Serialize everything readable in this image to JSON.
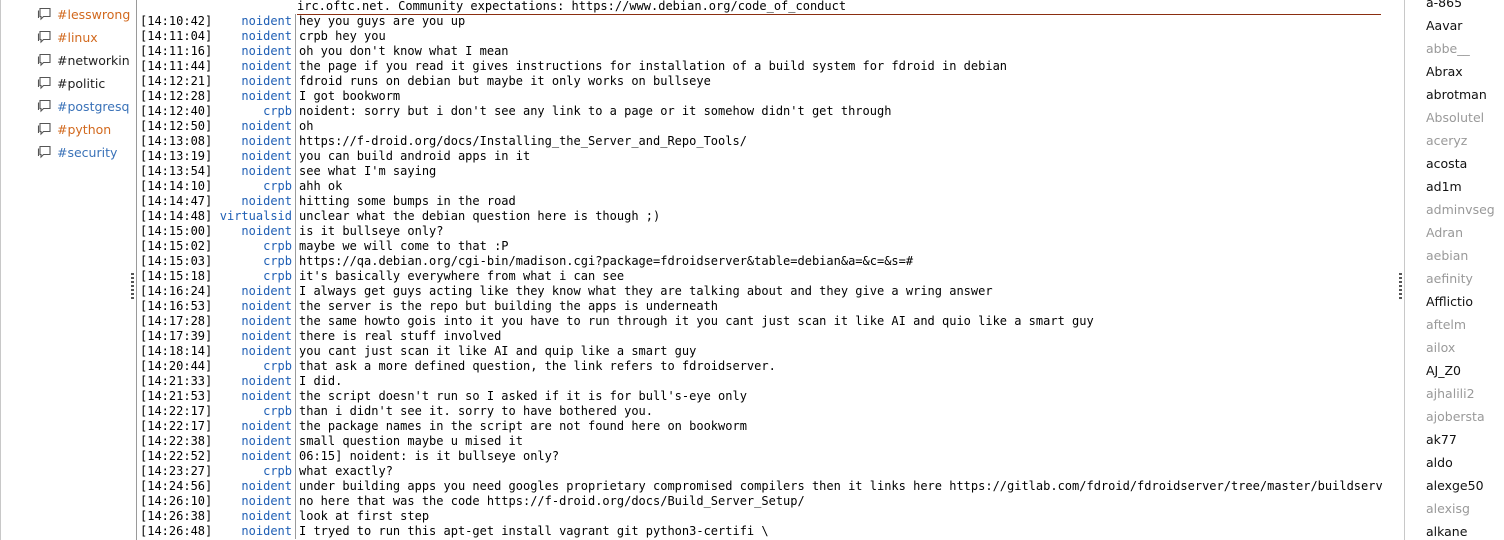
{
  "colors": {
    "nick": "#1f5fb5",
    "nick_virtualsid": "#1f5fb5",
    "chan_orange": "#d2691e",
    "chan_blue": "#3a72b8",
    "chan_dark": "#222222",
    "user_active": "#111111",
    "user_away": "#999999",
    "topic_border": "#8b2e10"
  },
  "channels": [
    {
      "label": "#lesswrong",
      "color": "orange",
      "icon": "chat-bubble-icon"
    },
    {
      "label": "#linux",
      "color": "orange",
      "icon": "chat-bubble-icon"
    },
    {
      "label": "#networkin",
      "color": "dark",
      "icon": "chat-bubble-icon"
    },
    {
      "label": "#politic",
      "color": "dark",
      "icon": "chat-bubble-icon"
    },
    {
      "label": "#postgresq",
      "color": "blue",
      "icon": "chat-bubble-icon"
    },
    {
      "label": "#python",
      "color": "orange",
      "icon": "chat-bubble-icon"
    },
    {
      "label": "#security",
      "color": "blue",
      "icon": "chat-bubble-icon"
    }
  ],
  "topic": "irc.oftc.net. Community expectations: https://www.debian.org/code_of_conduct",
  "messages": [
    {
      "ts": "[14:10:42]",
      "nick": "noident",
      "text": "hey you guys are you up"
    },
    {
      "ts": "[14:11:04]",
      "nick": "noident",
      "text": "crpb hey you"
    },
    {
      "ts": "[14:11:16]",
      "nick": "noident",
      "text": "oh you don't know what I mean"
    },
    {
      "ts": "[14:11:44]",
      "nick": "noident",
      "text": "the page if you read it gives instructions for installation of a build system for fdroid in debian"
    },
    {
      "ts": "[14:12:21]",
      "nick": "noident",
      "text": "fdroid runs on debian but maybe it only works on bullseye"
    },
    {
      "ts": "[14:12:28]",
      "nick": "noident",
      "text": "I got bookworm"
    },
    {
      "ts": "[14:12:40]",
      "nick": "crpb",
      "text": "noident: sorry but i don't see any link to a page or it somehow didn't get through"
    },
    {
      "ts": "[14:12:50]",
      "nick": "noident",
      "text": "oh"
    },
    {
      "ts": "[14:13:08]",
      "nick": "noident",
      "text": "https://f-droid.org/docs/Installing_the_Server_and_Repo_Tools/"
    },
    {
      "ts": "[14:13:19]",
      "nick": "noident",
      "text": "you can build android apps in it"
    },
    {
      "ts": "[14:13:54]",
      "nick": "noident",
      "text": "see what I'm saying"
    },
    {
      "ts": "[14:14:10]",
      "nick": "crpb",
      "text": "ahh ok"
    },
    {
      "ts": "[14:14:47]",
      "nick": "noident",
      "text": "hitting some bumps in the road"
    },
    {
      "ts": "[14:14:48]",
      "nick": "virtualsid",
      "text": "unclear what the debian question here is though ;)"
    },
    {
      "ts": "[14:15:00]",
      "nick": "noident",
      "text": "is it bullseye only?"
    },
    {
      "ts": "[14:15:02]",
      "nick": "crpb",
      "text": "maybe we will come to that :P"
    },
    {
      "ts": "[14:15:03]",
      "nick": "crpb",
      "text": "https://qa.debian.org/cgi-bin/madison.cgi?package=fdroidserver&table=debian&a=&c=&s=#"
    },
    {
      "ts": "[14:15:18]",
      "nick": "crpb",
      "text": "it's basically everywhere from what i can see"
    },
    {
      "ts": "[14:16:24]",
      "nick": "noident",
      "text": "I always get guys acting like they know what they are talking about and they give a wring answer"
    },
    {
      "ts": "[14:16:53]",
      "nick": "noident",
      "text": "the server is the repo but building the apps is underneath"
    },
    {
      "ts": "[14:17:28]",
      "nick": "noident",
      "text": "the same howto gois into it you have to run through it you cant just scan it like AI and quio like a smart guy"
    },
    {
      "ts": "[14:17:39]",
      "nick": "noident",
      "text": "there is real stuff involved"
    },
    {
      "ts": "[14:18:14]",
      "nick": "noident",
      "text": "you cant just scan it like AI and quip like a smart guy"
    },
    {
      "ts": "[14:20:44]",
      "nick": "crpb",
      "text": "that ask a more defined question, the link refers to fdroidserver."
    },
    {
      "ts": "[14:21:33]",
      "nick": "noident",
      "text": "I did."
    },
    {
      "ts": "[14:21:53]",
      "nick": "noident",
      "text": "the script doesn't run so I asked if it is for bull's-eye only"
    },
    {
      "ts": "[14:22:17]",
      "nick": "crpb",
      "text": "than i didn't see it. sorry to have bothered you."
    },
    {
      "ts": "[14:22:17]",
      "nick": "noident",
      "text": "the package names in the script are not found here on bookworm"
    },
    {
      "ts": "[14:22:38]",
      "nick": "noident",
      "text": "small question maybe u mised it"
    },
    {
      "ts": "[14:22:52]",
      "nick": "noident",
      "text": "06:15]  noident: is it bullseye only?"
    },
    {
      "ts": "[14:23:27]",
      "nick": "crpb",
      "text": "what exactly?"
    },
    {
      "ts": "[14:24:56]",
      "nick": "noident",
      "text": "under building apps you need googles proprietary compromised compilers then it links here https://gitlab.com/fdroid/fdroidserver/tree/master/buildserver/"
    },
    {
      "ts": "[14:26:10]",
      "nick": "noident",
      "text": "no here that was the code https://f-droid.org/docs/Build_Server_Setup/"
    },
    {
      "ts": "[14:26:38]",
      "nick": "noident",
      "text": "look at first step"
    },
    {
      "ts": "[14:26:48]",
      "nick": "noident",
      "text": "I tryed to run this apt-get install vagrant git python3-certifi \\"
    }
  ],
  "users": [
    {
      "name": "a-865",
      "away": false
    },
    {
      "name": "Aavar",
      "away": false
    },
    {
      "name": "abbe__",
      "away": true
    },
    {
      "name": "Abrax",
      "away": false
    },
    {
      "name": "abrotman",
      "away": false
    },
    {
      "name": "Absolutel",
      "away": true
    },
    {
      "name": "aceryz",
      "away": true
    },
    {
      "name": "acosta",
      "away": false
    },
    {
      "name": "ad1m",
      "away": false
    },
    {
      "name": "adminvseg",
      "away": true
    },
    {
      "name": "Adran",
      "away": true
    },
    {
      "name": "aebian",
      "away": true
    },
    {
      "name": "aefinity",
      "away": true
    },
    {
      "name": "Afflictio",
      "away": false
    },
    {
      "name": "aftelm",
      "away": true
    },
    {
      "name": "ailox",
      "away": true
    },
    {
      "name": "AJ_Z0",
      "away": false
    },
    {
      "name": "ajhalili2",
      "away": true
    },
    {
      "name": "ajobersta",
      "away": true
    },
    {
      "name": "ak77",
      "away": false
    },
    {
      "name": "aldo",
      "away": false
    },
    {
      "name": "alexge50",
      "away": false
    },
    {
      "name": "alexisg",
      "away": true
    },
    {
      "name": "alkane",
      "away": false
    }
  ]
}
